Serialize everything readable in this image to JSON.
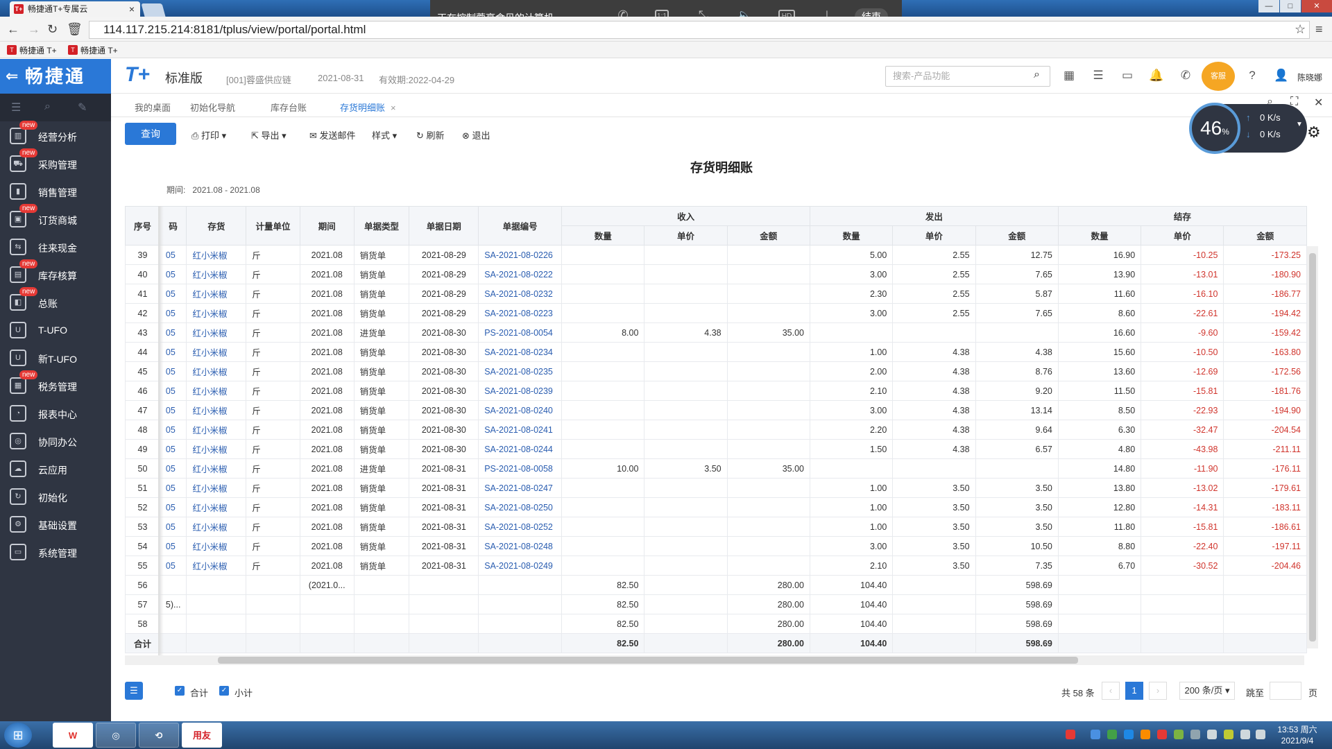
{
  "browser": {
    "tab_title": "畅捷通T+专属云",
    "url": "114.117.215.214:8181/tplus/view/portal/portal.html",
    "bookmarks": [
      "畅捷通 T+",
      "畅捷通 T+"
    ]
  },
  "remote": {
    "status": "正在控制蓉亭食贝的计算机",
    "end_label": "结束",
    "ratio_label": "1:1",
    "hd_label": "HD"
  },
  "header": {
    "logo": "畅捷通",
    "brand": "T+",
    "brand_sub": "标准版",
    "company": "[001]蓉盛供应链",
    "date": "2021-08-31",
    "validity": "有效期:2022-04-29",
    "search_placeholder": "搜索-产品功能",
    "username": "陈晓娜",
    "avatar_text": "客服"
  },
  "sidebar": {
    "items": [
      {
        "label": "经营分析",
        "new": true,
        "icon": "chart-icon"
      },
      {
        "label": "采购管理",
        "new": true,
        "icon": "cart-icon"
      },
      {
        "label": "销售管理",
        "new": false,
        "icon": "bar-icon"
      },
      {
        "label": "订货商城",
        "new": true,
        "icon": "shop-icon"
      },
      {
        "label": "往来现金",
        "new": false,
        "icon": "cash-icon"
      },
      {
        "label": "库存核算",
        "new": true,
        "icon": "stock-icon"
      },
      {
        "label": "总账",
        "new": true,
        "icon": "ledger-icon"
      },
      {
        "label": "T-UFO",
        "new": false,
        "icon": "ufo-icon"
      },
      {
        "label": "新T-UFO",
        "new": false,
        "icon": "ufo-new-icon"
      },
      {
        "label": "税务管理",
        "new": true,
        "icon": "tax-icon"
      },
      {
        "label": "报表中心",
        "new": false,
        "icon": "report-icon"
      },
      {
        "label": "协同办公",
        "new": false,
        "icon": "office-icon"
      },
      {
        "label": "云应用",
        "new": false,
        "icon": "cloud-icon"
      },
      {
        "label": "初始化",
        "new": false,
        "icon": "init-icon"
      },
      {
        "label": "基础设置",
        "new": false,
        "icon": "settings-icon"
      },
      {
        "label": "系统管理",
        "new": false,
        "icon": "system-icon"
      }
    ],
    "new_label": "new"
  },
  "tabs": [
    "我的桌面",
    "初始化导航",
    "库存台账",
    "存货明细账"
  ],
  "toolbar": {
    "query": "查询",
    "print": "打印",
    "export": "导出",
    "email": "发送邮件",
    "style": "样式",
    "refresh": "刷新",
    "exit": "退出"
  },
  "netwidget": {
    "percent": "46",
    "pct_sign": "%",
    "up": "0 K/s",
    "down": "0 K/s"
  },
  "report": {
    "title": "存货明细账",
    "period_label": "期间:",
    "period_value": "2021.08 - 2021.08"
  },
  "table": {
    "headers": {
      "seq": "序号",
      "code": "码",
      "item": "存货",
      "unit": "计量单位",
      "period": "期间",
      "doctype": "单据类型",
      "docdate": "单据日期",
      "docno": "单据编号",
      "in": "收入",
      "out": "发出",
      "bal": "结存",
      "qty": "数量",
      "price": "单价",
      "amount": "金额"
    },
    "rows": [
      [
        "39",
        "05",
        "红小米椒",
        "斤",
        "2021.08",
        "销货单",
        "2021-08-29",
        "SA-2021-08-0226",
        "",
        "",
        "",
        "5.00",
        "2.55",
        "12.75",
        "16.90",
        "-10.25",
        "-173.25"
      ],
      [
        "40",
        "05",
        "红小米椒",
        "斤",
        "2021.08",
        "销货单",
        "2021-08-29",
        "SA-2021-08-0222",
        "",
        "",
        "",
        "3.00",
        "2.55",
        "7.65",
        "13.90",
        "-13.01",
        "-180.90"
      ],
      [
        "41",
        "05",
        "红小米椒",
        "斤",
        "2021.08",
        "销货单",
        "2021-08-29",
        "SA-2021-08-0232",
        "",
        "",
        "",
        "2.30",
        "2.55",
        "5.87",
        "11.60",
        "-16.10",
        "-186.77"
      ],
      [
        "42",
        "05",
        "红小米椒",
        "斤",
        "2021.08",
        "销货单",
        "2021-08-29",
        "SA-2021-08-0223",
        "",
        "",
        "",
        "3.00",
        "2.55",
        "7.65",
        "8.60",
        "-22.61",
        "-194.42"
      ],
      [
        "43",
        "05",
        "红小米椒",
        "斤",
        "2021.08",
        "进货单",
        "2021-08-30",
        "PS-2021-08-0054",
        "8.00",
        "4.38",
        "35.00",
        "",
        "",
        "",
        "16.60",
        "-9.60",
        "-159.42"
      ],
      [
        "44",
        "05",
        "红小米椒",
        "斤",
        "2021.08",
        "销货单",
        "2021-08-30",
        "SA-2021-08-0234",
        "",
        "",
        "",
        "1.00",
        "4.38",
        "4.38",
        "15.60",
        "-10.50",
        "-163.80"
      ],
      [
        "45",
        "05",
        "红小米椒",
        "斤",
        "2021.08",
        "销货单",
        "2021-08-30",
        "SA-2021-08-0235",
        "",
        "",
        "",
        "2.00",
        "4.38",
        "8.76",
        "13.60",
        "-12.69",
        "-172.56"
      ],
      [
        "46",
        "05",
        "红小米椒",
        "斤",
        "2021.08",
        "销货单",
        "2021-08-30",
        "SA-2021-08-0239",
        "",
        "",
        "",
        "2.10",
        "4.38",
        "9.20",
        "11.50",
        "-15.81",
        "-181.76"
      ],
      [
        "47",
        "05",
        "红小米椒",
        "斤",
        "2021.08",
        "销货单",
        "2021-08-30",
        "SA-2021-08-0240",
        "",
        "",
        "",
        "3.00",
        "4.38",
        "13.14",
        "8.50",
        "-22.93",
        "-194.90"
      ],
      [
        "48",
        "05",
        "红小米椒",
        "斤",
        "2021.08",
        "销货单",
        "2021-08-30",
        "SA-2021-08-0241",
        "",
        "",
        "",
        "2.20",
        "4.38",
        "9.64",
        "6.30",
        "-32.47",
        "-204.54"
      ],
      [
        "49",
        "05",
        "红小米椒",
        "斤",
        "2021.08",
        "销货单",
        "2021-08-30",
        "SA-2021-08-0244",
        "",
        "",
        "",
        "1.50",
        "4.38",
        "6.57",
        "4.80",
        "-43.98",
        "-211.11"
      ],
      [
        "50",
        "05",
        "红小米椒",
        "斤",
        "2021.08",
        "进货单",
        "2021-08-31",
        "PS-2021-08-0058",
        "10.00",
        "3.50",
        "35.00",
        "",
        "",
        "",
        "14.80",
        "-11.90",
        "-176.11"
      ],
      [
        "51",
        "05",
        "红小米椒",
        "斤",
        "2021.08",
        "销货单",
        "2021-08-31",
        "SA-2021-08-0247",
        "",
        "",
        "",
        "1.00",
        "3.50",
        "3.50",
        "13.80",
        "-13.02",
        "-179.61"
      ],
      [
        "52",
        "05",
        "红小米椒",
        "斤",
        "2021.08",
        "销货单",
        "2021-08-31",
        "SA-2021-08-0250",
        "",
        "",
        "",
        "1.00",
        "3.50",
        "3.50",
        "12.80",
        "-14.31",
        "-183.11"
      ],
      [
        "53",
        "05",
        "红小米椒",
        "斤",
        "2021.08",
        "销货单",
        "2021-08-31",
        "SA-2021-08-0252",
        "",
        "",
        "",
        "1.00",
        "3.50",
        "3.50",
        "11.80",
        "-15.81",
        "-186.61"
      ],
      [
        "54",
        "05",
        "红小米椒",
        "斤",
        "2021.08",
        "销货单",
        "2021-08-31",
        "SA-2021-08-0248",
        "",
        "",
        "",
        "3.00",
        "3.50",
        "10.50",
        "8.80",
        "-22.40",
        "-197.11"
      ],
      [
        "55",
        "05",
        "红小米椒",
        "斤",
        "2021.08",
        "销货单",
        "2021-08-31",
        "SA-2021-08-0249",
        "",
        "",
        "",
        "2.10",
        "3.50",
        "7.35",
        "6.70",
        "-30.52",
        "-204.46"
      ]
    ],
    "subtotals": [
      [
        "56",
        "",
        "",
        "",
        "(2021.0...",
        "",
        "",
        "",
        "82.50",
        "",
        "280.00",
        "104.40",
        "",
        "598.69",
        "",
        "",
        ""
      ],
      [
        "57",
        "5)...",
        "",
        "",
        "",
        "",
        "",
        "",
        "82.50",
        "",
        "280.00",
        "104.40",
        "",
        "598.69",
        "",
        "",
        ""
      ],
      [
        "58",
        "",
        "",
        "",
        "",
        "",
        "",
        "",
        "82.50",
        "",
        "280.00",
        "104.40",
        "",
        "598.69",
        "",
        "",
        ""
      ]
    ],
    "total": [
      "合计",
      "",
      "",
      "",
      "",
      "",
      "",
      "",
      "82.50",
      "",
      "280.00",
      "104.40",
      "",
      "598.69",
      "",
      "",
      ""
    ]
  },
  "footer": {
    "chk_total": "合计",
    "chk_subtotal": "小计",
    "count": "共 58 条",
    "page": "1",
    "page_size": "200 条/页",
    "goto": "跳至",
    "page_unit": "页"
  },
  "taskbar": {
    "apps": [
      "W",
      "",
      "",
      "用友"
    ],
    "time": "13:53 周六",
    "date": "2021/9/4"
  }
}
